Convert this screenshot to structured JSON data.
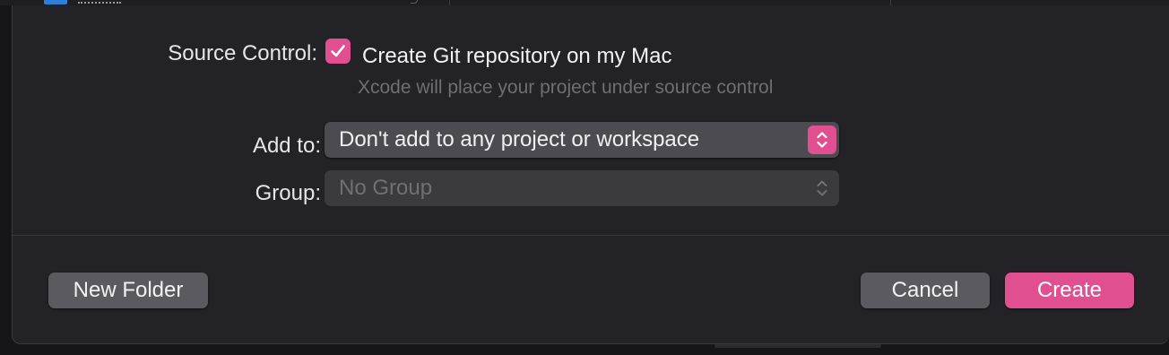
{
  "source_control": {
    "label": "Source Control:",
    "checkbox_checked": true,
    "checkbox_label": "Create Git repository on my Mac",
    "hint": "Xcode will place your project under source control"
  },
  "add_to": {
    "label": "Add to:",
    "selected": "Don't add to any project or workspace"
  },
  "group": {
    "label": "Group:",
    "selected": "No Group",
    "enabled": false
  },
  "buttons": {
    "new_folder": "New Folder",
    "cancel": "Cancel",
    "create": "Create"
  },
  "colors": {
    "accent": "#e04f8f",
    "sheet_background": "#222227",
    "button_gray": "#5a5a60"
  },
  "icons": {
    "checkbox": "checkmark-icon",
    "popup": "up-down-chevrons-icon"
  }
}
